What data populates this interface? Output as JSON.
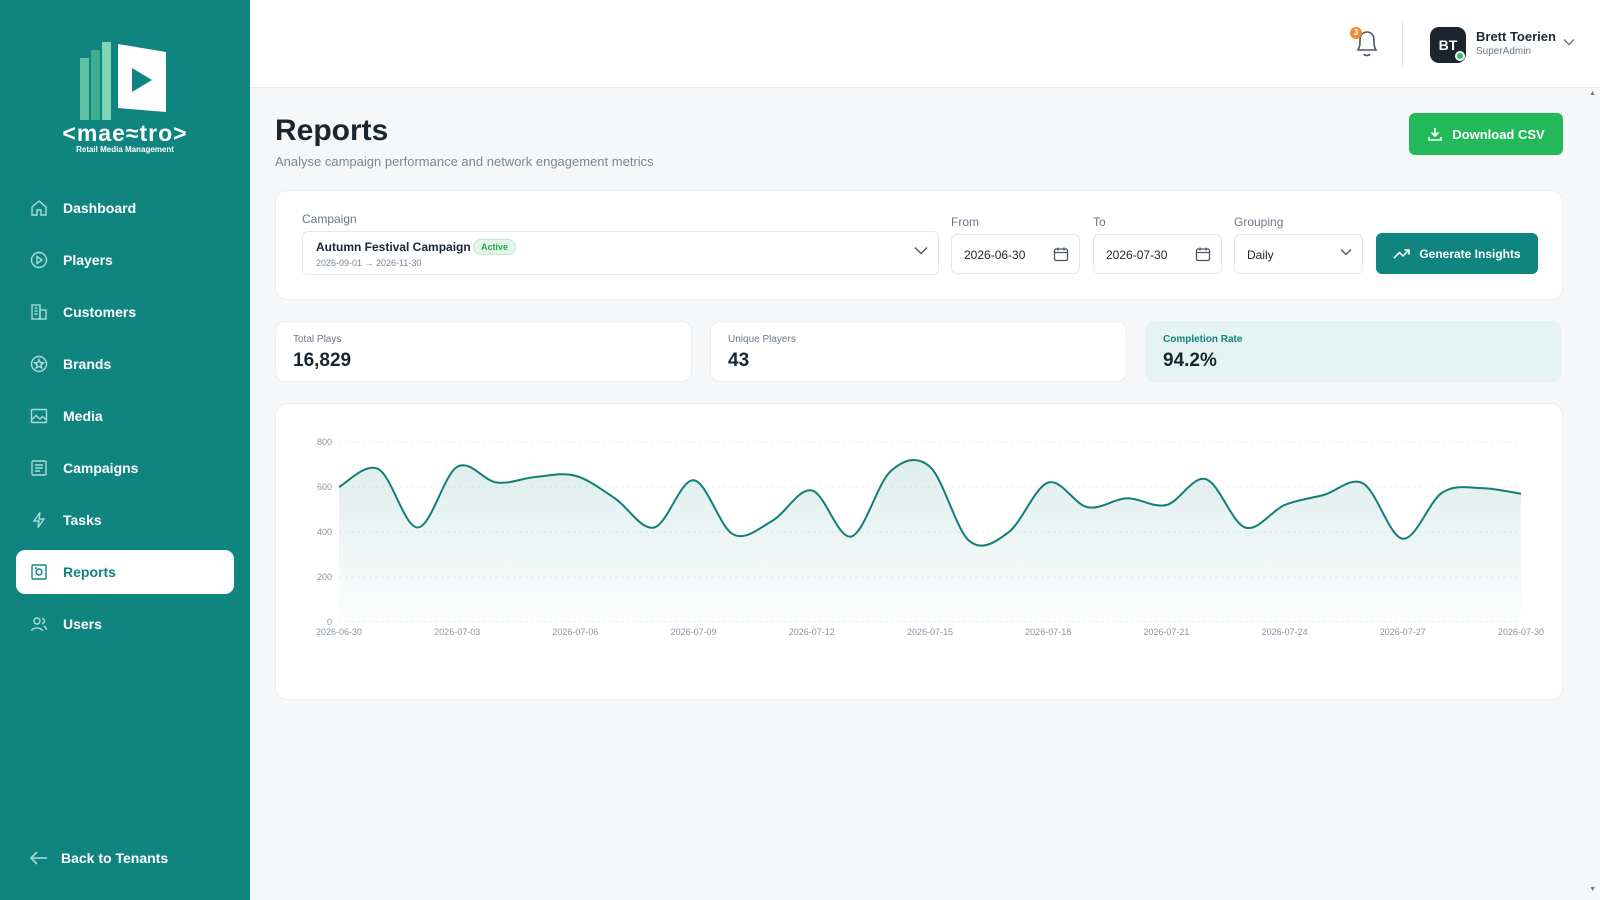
{
  "brand": {
    "name": "<mae≈tro>",
    "tagline": "Retail Media Management"
  },
  "sidebar": {
    "items": [
      {
        "label": "Dashboard",
        "icon": "home-icon"
      },
      {
        "label": "Players",
        "icon": "play-circle-icon"
      },
      {
        "label": "Customers",
        "icon": "building-icon"
      },
      {
        "label": "Brands",
        "icon": "star-icon"
      },
      {
        "label": "Media",
        "icon": "image-icon"
      },
      {
        "label": "Campaigns",
        "icon": "newspaper-icon"
      },
      {
        "label": "Tasks",
        "icon": "bolt-icon"
      },
      {
        "label": "Reports",
        "icon": "report-icon",
        "active": true
      },
      {
        "label": "Users",
        "icon": "users-icon"
      }
    ],
    "back_label": "Back to Tenants"
  },
  "topbar": {
    "notification_count": "3",
    "user": {
      "initials": "BT",
      "name": "Brett Toerien",
      "role": "SuperAdmin"
    }
  },
  "page": {
    "title": "Reports",
    "subtitle": "Analyse campaign performance and network engagement metrics",
    "download_label": "Download CSV"
  },
  "filters": {
    "campaign_label": "Campaign",
    "campaign_name": "Autumn Festival Campaign",
    "campaign_status": "Active",
    "campaign_dates": "2026-09-01 → 2026-11-30",
    "from_label": "From",
    "from_value": "2026-06-30",
    "to_label": "To",
    "to_value": "2026-07-30",
    "grouping_label": "Grouping",
    "grouping_value": "Daily",
    "insights_label": "Generate Insights"
  },
  "kpis": [
    {
      "label": "Total Plays",
      "value": "16,829"
    },
    {
      "label": "Unique Players",
      "value": "43"
    },
    {
      "label": "Completion Rate",
      "value": "94.2%"
    }
  ],
  "colors": {
    "sidebar": "#108580",
    "accent": "#108580",
    "download_button": "#22b95a",
    "line": "#137e78"
  },
  "chart_data": {
    "type": "area",
    "title": "",
    "xlabel": "",
    "ylabel": "",
    "ylim": [
      0,
      800
    ],
    "yticks": [
      0,
      200,
      400,
      600,
      800
    ],
    "x_tick_labels": [
      "2026-06-30",
      "2026-07-03",
      "2026-07-06",
      "2026-07-09",
      "2026-07-12",
      "2026-07-15",
      "2026-07-18",
      "2026-07-21",
      "2026-07-24",
      "2026-07-27",
      "2026-07-30"
    ],
    "grid": true,
    "series": [
      {
        "x": [
          "2026-06-30",
          "2026-07-01",
          "2026-07-02",
          "2026-07-03",
          "2026-07-04",
          "2026-07-05",
          "2026-07-06",
          "2026-07-07",
          "2026-07-08",
          "2026-07-09",
          "2026-07-10",
          "2026-07-11",
          "2026-07-12",
          "2026-07-13",
          "2026-07-14",
          "2026-07-15",
          "2026-07-16",
          "2026-07-17",
          "2026-07-18",
          "2026-07-19",
          "2026-07-20",
          "2026-07-21",
          "2026-07-22",
          "2026-07-23",
          "2026-07-24",
          "2026-07-25",
          "2026-07-26",
          "2026-07-27",
          "2026-07-28",
          "2026-07-29",
          "2026-07-30"
        ],
        "values": [
          600,
          680,
          420,
          690,
          620,
          645,
          650,
          550,
          420,
          630,
          390,
          450,
          585,
          380,
          670,
          690,
          360,
          400,
          620,
          510,
          550,
          520,
          635,
          420,
          520,
          565,
          615,
          370,
          575,
          595,
          570
        ]
      }
    ]
  }
}
